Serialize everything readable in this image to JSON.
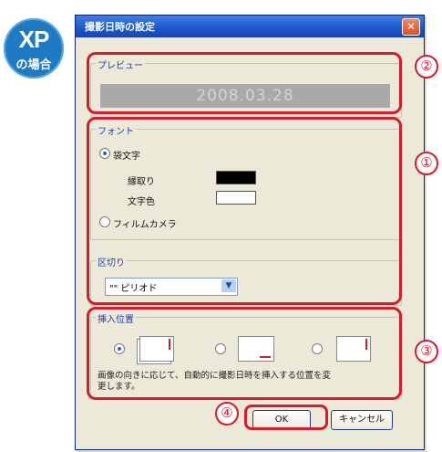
{
  "badge": {
    "line1": "XP",
    "line2": "の場合"
  },
  "window": {
    "title": "撮影日時の設定",
    "close_glyph": "✕"
  },
  "preview": {
    "label": "プレビュー",
    "text": "2008.03.28"
  },
  "font_group": {
    "label": "フォント",
    "option_outline_text": "袋文字",
    "border_label": "縁取り",
    "text_color_label": "文字色",
    "option_film": "フィルムカメラ",
    "border_color": "#000000",
    "text_color": "#ffffff"
  },
  "separator": {
    "label": "区切り",
    "value": "\"\" ピリオド"
  },
  "position": {
    "label": "挿入位置",
    "description_line1": "画像の向きに応じて、自動的に撮影日時を挿入する位置を変",
    "description_line2": "更します。"
  },
  "buttons": {
    "ok": "OK",
    "cancel": "キャンセル"
  },
  "annotations": [
    "②",
    "①",
    "③",
    "④"
  ]
}
